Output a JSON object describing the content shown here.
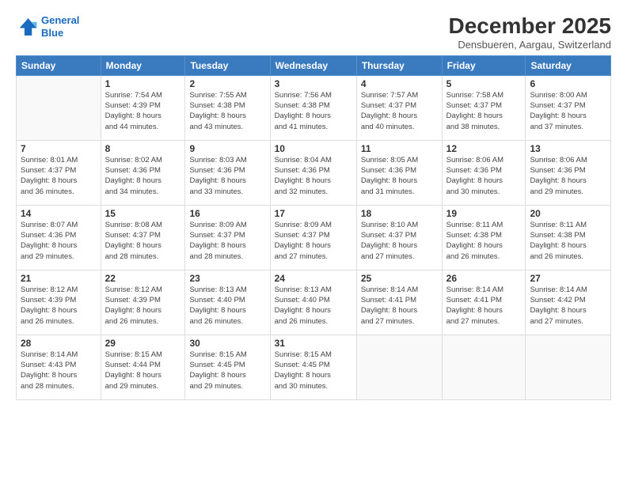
{
  "logo": {
    "line1": "General",
    "line2": "Blue"
  },
  "title": "December 2025",
  "subtitle": "Densbueren, Aargau, Switzerland",
  "days_header": [
    "Sunday",
    "Monday",
    "Tuesday",
    "Wednesday",
    "Thursday",
    "Friday",
    "Saturday"
  ],
  "weeks": [
    [
      {
        "num": "",
        "info": ""
      },
      {
        "num": "1",
        "info": "Sunrise: 7:54 AM\nSunset: 4:39 PM\nDaylight: 8 hours\nand 44 minutes."
      },
      {
        "num": "2",
        "info": "Sunrise: 7:55 AM\nSunset: 4:38 PM\nDaylight: 8 hours\nand 43 minutes."
      },
      {
        "num": "3",
        "info": "Sunrise: 7:56 AM\nSunset: 4:38 PM\nDaylight: 8 hours\nand 41 minutes."
      },
      {
        "num": "4",
        "info": "Sunrise: 7:57 AM\nSunset: 4:37 PM\nDaylight: 8 hours\nand 40 minutes."
      },
      {
        "num": "5",
        "info": "Sunrise: 7:58 AM\nSunset: 4:37 PM\nDaylight: 8 hours\nand 38 minutes."
      },
      {
        "num": "6",
        "info": "Sunrise: 8:00 AM\nSunset: 4:37 PM\nDaylight: 8 hours\nand 37 minutes."
      }
    ],
    [
      {
        "num": "7",
        "info": "Sunrise: 8:01 AM\nSunset: 4:37 PM\nDaylight: 8 hours\nand 36 minutes."
      },
      {
        "num": "8",
        "info": "Sunrise: 8:02 AM\nSunset: 4:36 PM\nDaylight: 8 hours\nand 34 minutes."
      },
      {
        "num": "9",
        "info": "Sunrise: 8:03 AM\nSunset: 4:36 PM\nDaylight: 8 hours\nand 33 minutes."
      },
      {
        "num": "10",
        "info": "Sunrise: 8:04 AM\nSunset: 4:36 PM\nDaylight: 8 hours\nand 32 minutes."
      },
      {
        "num": "11",
        "info": "Sunrise: 8:05 AM\nSunset: 4:36 PM\nDaylight: 8 hours\nand 31 minutes."
      },
      {
        "num": "12",
        "info": "Sunrise: 8:06 AM\nSunset: 4:36 PM\nDaylight: 8 hours\nand 30 minutes."
      },
      {
        "num": "13",
        "info": "Sunrise: 8:06 AM\nSunset: 4:36 PM\nDaylight: 8 hours\nand 29 minutes."
      }
    ],
    [
      {
        "num": "14",
        "info": "Sunrise: 8:07 AM\nSunset: 4:36 PM\nDaylight: 8 hours\nand 29 minutes."
      },
      {
        "num": "15",
        "info": "Sunrise: 8:08 AM\nSunset: 4:37 PM\nDaylight: 8 hours\nand 28 minutes."
      },
      {
        "num": "16",
        "info": "Sunrise: 8:09 AM\nSunset: 4:37 PM\nDaylight: 8 hours\nand 28 minutes."
      },
      {
        "num": "17",
        "info": "Sunrise: 8:09 AM\nSunset: 4:37 PM\nDaylight: 8 hours\nand 27 minutes."
      },
      {
        "num": "18",
        "info": "Sunrise: 8:10 AM\nSunset: 4:37 PM\nDaylight: 8 hours\nand 27 minutes."
      },
      {
        "num": "19",
        "info": "Sunrise: 8:11 AM\nSunset: 4:38 PM\nDaylight: 8 hours\nand 26 minutes."
      },
      {
        "num": "20",
        "info": "Sunrise: 8:11 AM\nSunset: 4:38 PM\nDaylight: 8 hours\nand 26 minutes."
      }
    ],
    [
      {
        "num": "21",
        "info": "Sunrise: 8:12 AM\nSunset: 4:39 PM\nDaylight: 8 hours\nand 26 minutes."
      },
      {
        "num": "22",
        "info": "Sunrise: 8:12 AM\nSunset: 4:39 PM\nDaylight: 8 hours\nand 26 minutes."
      },
      {
        "num": "23",
        "info": "Sunrise: 8:13 AM\nSunset: 4:40 PM\nDaylight: 8 hours\nand 26 minutes."
      },
      {
        "num": "24",
        "info": "Sunrise: 8:13 AM\nSunset: 4:40 PM\nDaylight: 8 hours\nand 26 minutes."
      },
      {
        "num": "25",
        "info": "Sunrise: 8:14 AM\nSunset: 4:41 PM\nDaylight: 8 hours\nand 27 minutes."
      },
      {
        "num": "26",
        "info": "Sunrise: 8:14 AM\nSunset: 4:41 PM\nDaylight: 8 hours\nand 27 minutes."
      },
      {
        "num": "27",
        "info": "Sunrise: 8:14 AM\nSunset: 4:42 PM\nDaylight: 8 hours\nand 27 minutes."
      }
    ],
    [
      {
        "num": "28",
        "info": "Sunrise: 8:14 AM\nSunset: 4:43 PM\nDaylight: 8 hours\nand 28 minutes."
      },
      {
        "num": "29",
        "info": "Sunrise: 8:15 AM\nSunset: 4:44 PM\nDaylight: 8 hours\nand 29 minutes."
      },
      {
        "num": "30",
        "info": "Sunrise: 8:15 AM\nSunset: 4:45 PM\nDaylight: 8 hours\nand 29 minutes."
      },
      {
        "num": "31",
        "info": "Sunrise: 8:15 AM\nSunset: 4:45 PM\nDaylight: 8 hours\nand 30 minutes."
      },
      {
        "num": "",
        "info": ""
      },
      {
        "num": "",
        "info": ""
      },
      {
        "num": "",
        "info": ""
      }
    ]
  ]
}
